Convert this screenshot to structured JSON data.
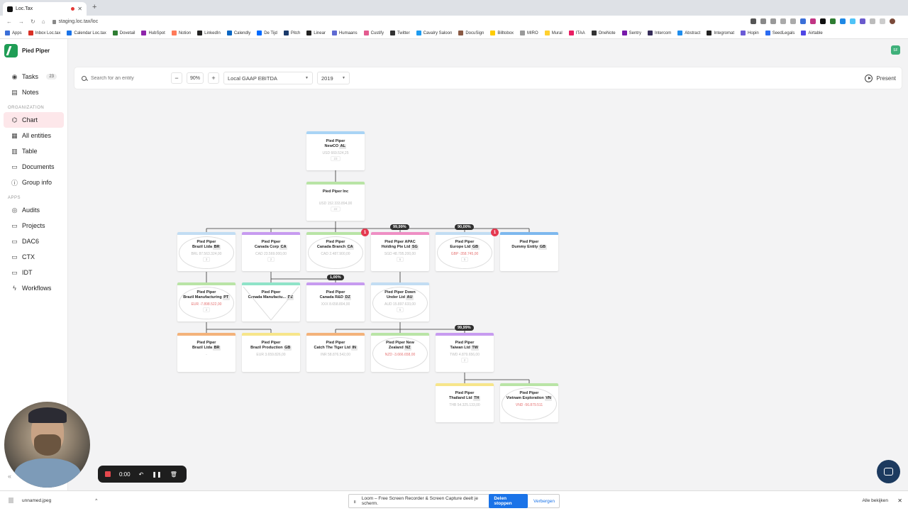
{
  "browser": {
    "tab_title": "Loc.Tax",
    "url": "staging.loc.tax/loc",
    "bookmarks": [
      "Apps",
      "Inbox Loc.tax",
      "Calendar Loc.tax",
      "Dovetail",
      "HubSpot",
      "Notion",
      "LinkedIn",
      "Calendly",
      "De Tijd",
      "Pitch",
      "Linear",
      "Humaans",
      "Custify",
      "Twitter",
      "Cavalry Saloon",
      "DocuSign",
      "Billtobox",
      "MIRO",
      "Mural",
      "ITAA",
      "OneNote",
      "Sentry",
      "Intercom",
      "Abstract",
      "Integromat",
      "Hopin",
      "SeedLegals",
      "Airtable"
    ]
  },
  "sidebar": {
    "org_name": "Pied Piper",
    "top_items": [
      {
        "label": "Tasks",
        "badge": "23",
        "icon": "check-circle-icon"
      },
      {
        "label": "Notes",
        "icon": "notes-icon"
      }
    ],
    "section_org": "ORGANIZATION",
    "org_items": [
      {
        "label": "Chart",
        "icon": "org-chart-icon",
        "active": true
      },
      {
        "label": "All entities",
        "icon": "entities-icon"
      },
      {
        "label": "Table",
        "icon": "table-icon"
      },
      {
        "label": "Documents",
        "icon": "document-icon"
      },
      {
        "label": "Group info",
        "icon": "info-icon"
      }
    ],
    "section_apps": "APPS",
    "app_items": [
      {
        "label": "Audits",
        "icon": "audit-icon"
      },
      {
        "label": "Projects",
        "icon": "folder-icon"
      },
      {
        "label": "DAC6",
        "icon": "folder-icon"
      },
      {
        "label": "CTX",
        "icon": "folder-icon"
      },
      {
        "label": "IDT",
        "icon": "folder-icon"
      },
      {
        "label": "Workflows",
        "icon": "bolt-icon"
      }
    ]
  },
  "user_avatar": "SF",
  "toolbar": {
    "search_placeholder": "Search for an entity",
    "zoom_out": "−",
    "zoom": "90%",
    "zoom_in": "+",
    "metric": "Local GAAP EBITDA",
    "year": "2019",
    "present": "Present"
  },
  "chart_nodes": [
    {
      "l1": "Pied Piper",
      "l2": "NewCO",
      "cc": "AL",
      "value": "USD 669.524,25",
      "count": "23",
      "color": "#a9d4f5"
    },
    {
      "l1": "Pied Piper Inc",
      "l2": "",
      "cc": "US",
      "value": "USD 152.333.894,00",
      "count": "22",
      "color": "#b9e4a6"
    },
    {
      "l1": "Pied Piper",
      "l2": "Brazil Ltda",
      "cc": "BR",
      "value": "BRL 87.563.324,00",
      "count": "3",
      "color": "#c2ddf3"
    },
    {
      "l1": "Pied Piper",
      "l2": "Canada Corp",
      "cc": "CA",
      "value": "CAD 23.569.000,00",
      "count": "2",
      "color": "#c79bf0"
    },
    {
      "l1": "Pied Piper",
      "l2": "Canada Branch",
      "cc": "CA",
      "value": "CAD 2.487.900,00",
      "count": "",
      "color": "#b9e4a6"
    },
    {
      "l1": "Pied Piper APAC",
      "l2": "Holding Pte Ltd",
      "cc": "SG",
      "value": "SGD 48.795.200,00",
      "count": "6",
      "color": "#ee8fc4"
    },
    {
      "l1": "Pied Piper",
      "l2": "Europe Ltd",
      "cc": "GB",
      "value": "GBP -358.745,00",
      "count": "5",
      "color": "#c2ddf3"
    },
    {
      "l1": "Pied Piper",
      "l2": "Dummy Entity",
      "cc": "GB",
      "value": "",
      "count": "",
      "color": "#7db8ee"
    },
    {
      "l1": "Pied Piper",
      "l2": "Brazil Manufacturing",
      "cc": "PT",
      "value": "EUR -7.898.522,00",
      "count": "2",
      "color": "#b9e4a6"
    },
    {
      "l1": "Pied Piper",
      "l2": "Canada Manufactu...",
      "cc": "DZ",
      "value": "",
      "count": "",
      "color": "#8fe3c8"
    },
    {
      "l1": "Pied Piper",
      "l2": "Canada R&D",
      "cc": "DZ",
      "value": "XXX 8.658.804,00",
      "count": "",
      "color": "#c79bf0"
    },
    {
      "l1": "Pied Piper Down",
      "l2": "Under Ltd",
      "cc": "AU",
      "value": "AUD 15.897.633,00",
      "count": "5",
      "color": "#c2ddf3"
    },
    {
      "l1": "Pied Piper",
      "l2": "Brazil Ltda",
      "cc": "BR",
      "value": "-",
      "count": "",
      "color": "#f3b27a"
    },
    {
      "l1": "Pied Piper",
      "l2": "Brazil Production",
      "cc": "GB",
      "value": "EUR 3.659.826,00",
      "count": "",
      "color": "#f7e58a"
    },
    {
      "l1": "Pied Piper",
      "l2": "Catch The Tiger Ltd",
      "cc": "IN",
      "value": "INR 58.876.542,00",
      "count": "",
      "color": "#f3b27a"
    },
    {
      "l1": "Pied Piper New",
      "l2": "Zealand",
      "cc": "NZ",
      "value": "NZD -3.666.658,00",
      "count": "",
      "color": "#b9e4a6"
    },
    {
      "l1": "Pied Piper",
      "l2": "Taiwan Ltd",
      "cc": "TW",
      "value": "TWD 4.879.656,00",
      "count": "2",
      "color": "#c79bf0"
    },
    {
      "l1": "Pied Piper",
      "l2": "Thailand Ltd",
      "cc": "TH",
      "value": "THB 54.325.133,00",
      "count": "",
      "color": "#f7e58a"
    },
    {
      "l1": "Pied Piper",
      "l2": "Vietnam Exploration",
      "cc": "VN",
      "value": "VND -56.879.511",
      "count": "",
      "color": "#b9e4a6"
    }
  ],
  "ownership_labels": [
    "99,99%",
    "90,00%",
    "1,00%",
    "99,99%"
  ],
  "alerts": [
    "1",
    "1"
  ],
  "recorder": {
    "time": "0:00"
  },
  "bottom": {
    "download_file": "unnamed.jpeg",
    "share_text": "Loom – Free Screen Recorder & Screen Capture deelt je scherm.",
    "stop_sharing": "Delen stoppen",
    "hide": "Verbergen",
    "view_all": "Alle bekijken"
  }
}
